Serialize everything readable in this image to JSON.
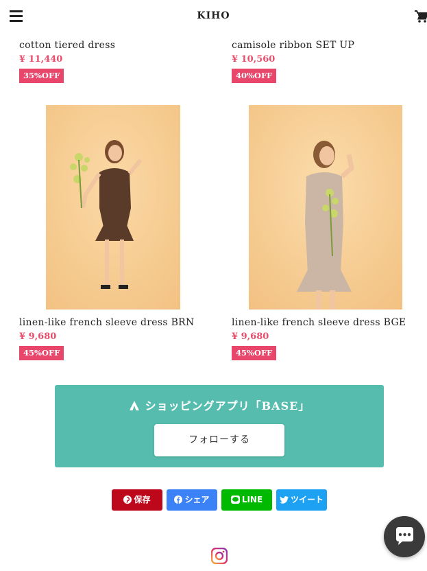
{
  "header": {
    "logo": "KIHO",
    "menu_icon": "hamburger-menu-icon",
    "cart_icon": "cart-icon"
  },
  "products": [
    {
      "name": "cotton tiered dress",
      "price": "¥ 11,440",
      "badge": "35%OFF"
    },
    {
      "name": "camisole ribbon SET UP",
      "price": "¥ 10,560",
      "badge": "40%OFF"
    },
    {
      "name": "linen-like french sleeve dress BRN",
      "price": "¥ 9,680",
      "badge": "45%OFF"
    },
    {
      "name": "linen-like french sleeve dress BGE",
      "price": "¥ 9,680",
      "badge": "45%OFF"
    }
  ],
  "base_app": {
    "title": "ショッピングアプリ「BASE」",
    "follow_label": "フォローする",
    "color": "#56bcad"
  },
  "share": {
    "pinterest": "保存",
    "facebook": "シェア",
    "line": "LINE",
    "twitter": "ツイート"
  },
  "colors": {
    "price": "#e84e6b",
    "badge": "#e8466b",
    "pinterest": "#bd081c",
    "facebook": "#3b82f6",
    "line": "#00b900",
    "twitter": "#1da1f2"
  },
  "footer": {
    "instagram_icon": "instagram-icon"
  },
  "chat": {
    "icon": "chat-bubble-icon"
  }
}
